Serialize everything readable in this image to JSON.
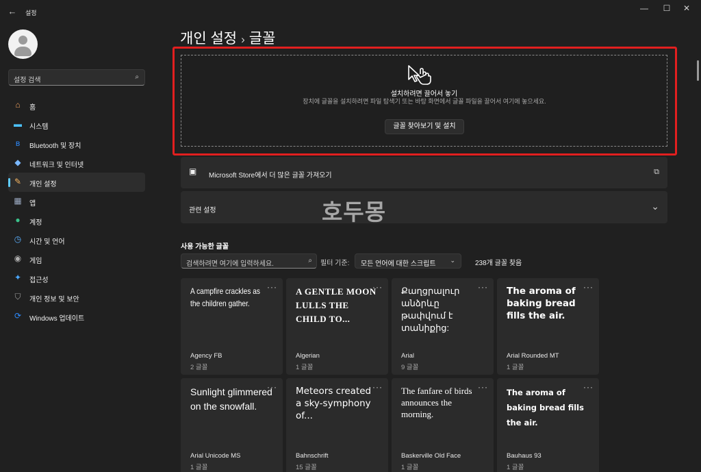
{
  "window": {
    "title": "설정",
    "back_icon": "←",
    "minimize": "—",
    "maximize": "☐",
    "close": "✕"
  },
  "sidebar": {
    "search_placeholder": "설정 검색",
    "search_icon": "⌕",
    "items": [
      {
        "label": "홈",
        "icon": "home-icon",
        "glyph": "⌂",
        "color": "#f0a060"
      },
      {
        "label": "시스템",
        "icon": "system-icon",
        "glyph": "▬",
        "color": "#4cc2ff"
      },
      {
        "label": "Bluetooth 및 장치",
        "icon": "bluetooth-icon",
        "glyph": "ʙ",
        "color": "#2d8cff"
      },
      {
        "label": "네트워크 및 인터넷",
        "icon": "network-icon",
        "glyph": "◆",
        "color": "#7ab8ff"
      },
      {
        "label": "개인 설정",
        "icon": "personalization-icon",
        "glyph": "✎",
        "color": "#f5b562",
        "selected": true
      },
      {
        "label": "앱",
        "icon": "apps-icon",
        "glyph": "▦",
        "color": "#9aa8c0"
      },
      {
        "label": "계정",
        "icon": "accounts-icon",
        "glyph": "●",
        "color": "#3ac28b"
      },
      {
        "label": "시간 및 언어",
        "icon": "time-language-icon",
        "glyph": "◷",
        "color": "#5ab0ff"
      },
      {
        "label": "게임",
        "icon": "gaming-icon",
        "glyph": "◉",
        "color": "#b0b0b0"
      },
      {
        "label": "접근성",
        "icon": "accessibility-icon",
        "glyph": "✦",
        "color": "#4aa8ff"
      },
      {
        "label": "개인 정보 및 보안",
        "icon": "shield-icon",
        "glyph": "⛉",
        "color": "#a0a0a0"
      },
      {
        "label": "Windows 업데이트",
        "icon": "update-icon",
        "glyph": "⟳",
        "color": "#2d8cff"
      }
    ]
  },
  "main": {
    "breadcrumb_parent": "개인 설정",
    "breadcrumb_sep": "›",
    "breadcrumb_current": "글꼴",
    "dropzone": {
      "title": "설치하려면 끌어서 놓기",
      "description": "장치에 글꼴을 설치하려면 파일 탐색기 또는 바탕 화면에서 글꼴 파일을 끌어서 여기에 놓으세요.",
      "button": "글꼴 찾아보기 및 설치"
    },
    "store_row": {
      "label": "Microsoft Store에서 더 많은 글꼴 가져오기",
      "trail_icon": "⧉"
    },
    "related_row": {
      "label": "관련 설정",
      "trail_icon": "⌄"
    },
    "watermark": "호두몽",
    "available_title": "사용 가능한 글꼴",
    "font_search_placeholder": "검색하려면 여기에 입력하세요.",
    "filter_label": "필터 기준:",
    "filter_value": "모든 언어에 대한 스크립트",
    "found_count": "238개 글꼴 찾음",
    "more_icon": "···",
    "fonts": [
      {
        "preview": "A campfire crackles as the children gather.",
        "name": "Agency FB",
        "count": "2 글꼴",
        "cls": "pv-agency"
      },
      {
        "preview": "A GENTLE MOON LULLS THE CHILD TO...",
        "name": "Algerian",
        "count": "1 글꼴",
        "cls": "pv-algerian"
      },
      {
        "preview": "Քաղցրալուր անձրևը թափվում է տանիքից:",
        "name": "Arial",
        "count": "9 글꼴",
        "cls": "pv-arial"
      },
      {
        "preview": "The aroma of baking bread fills the air.",
        "name": "Arial Rounded MT",
        "count": "1 글꼴",
        "cls": "pv-arialrounded"
      },
      {
        "preview": "Sunlight glimmered on the snowfall.",
        "name": "Arial Unicode MS",
        "count": "1 글꼴",
        "cls": "pv-unicode"
      },
      {
        "preview": "Meteors created a sky-symphony of...",
        "name": "Bahnschrift",
        "count": "15 글꼴",
        "cls": "pv-bahn"
      },
      {
        "preview": "The fanfare of birds announces the morning.",
        "name": "Baskerville Old Face",
        "count": "1 글꼴",
        "cls": "pv-basker"
      },
      {
        "preview": "The aroma of baking bread fills the air.",
        "name": "Bauhaus 93",
        "count": "1 글꼴",
        "cls": "pv-bauhaus"
      }
    ]
  }
}
